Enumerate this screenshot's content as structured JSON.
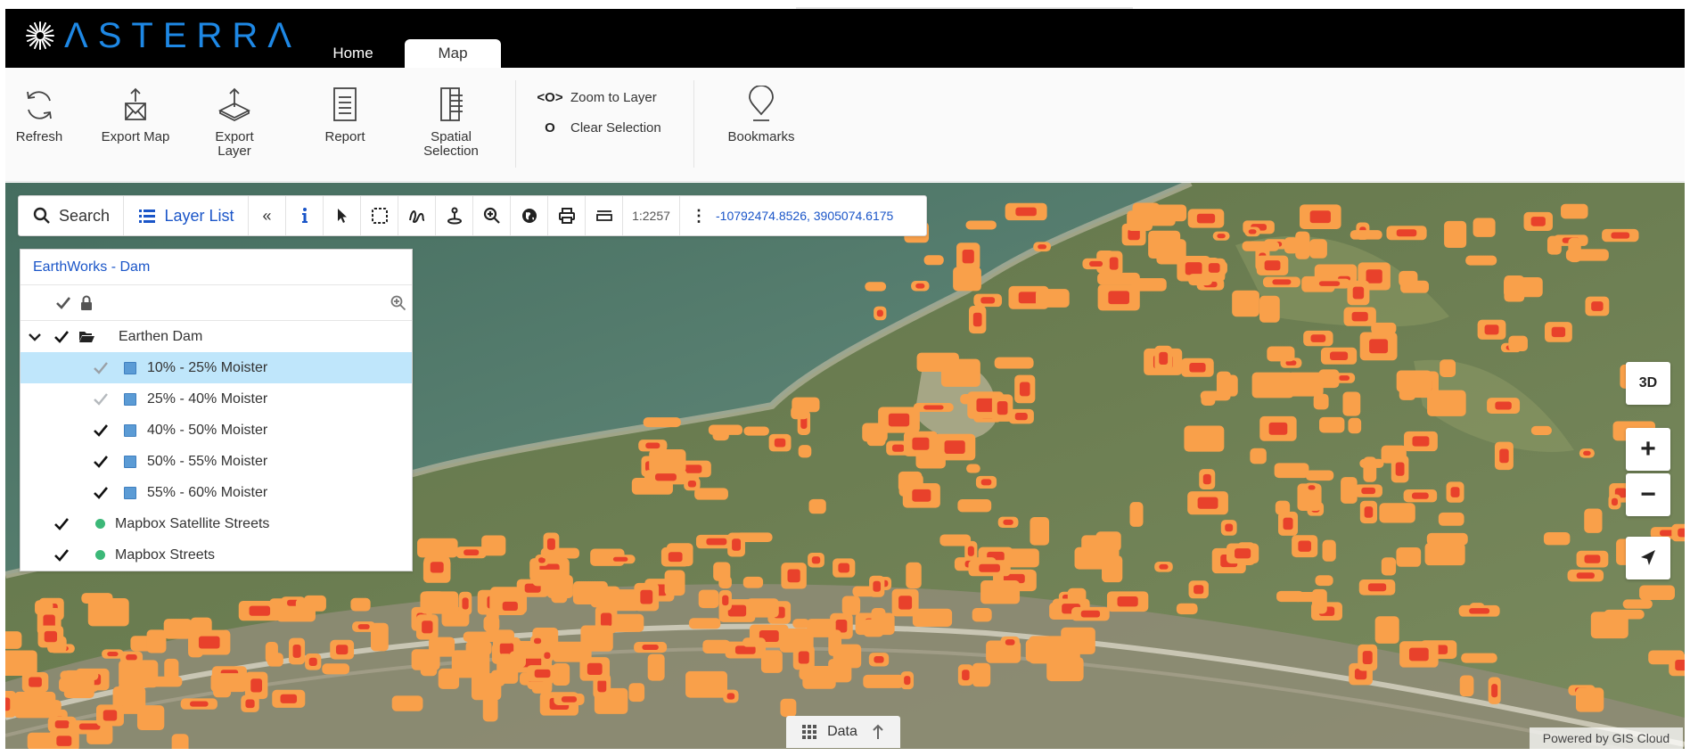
{
  "brand": {
    "logo_text": "ΛSTERRΛ"
  },
  "tabs": [
    {
      "label": "Home"
    },
    {
      "label": "Map"
    }
  ],
  "ribbon": {
    "refresh": "Refresh",
    "export_map": "Export Map",
    "export_layer_1": "Export",
    "export_layer_2": "Layer",
    "report": "Report",
    "spatial_1": "Spatial",
    "spatial_2": "Selection",
    "zoom_glyph": "<O>",
    "zoom_to_layer": "Zoom to Layer",
    "clear_glyph": "O",
    "clear_selection": "Clear Selection",
    "bookmarks": "Bookmarks"
  },
  "toolbar": {
    "search": "Search",
    "layer_list": "Layer List",
    "collapse": "«",
    "scale": "1:2257",
    "coordinates": "-10792474.8526, 3905074.6175"
  },
  "layer_panel": {
    "title_project": "EarthWorks",
    "title_sep": " - ",
    "title_layer": "Dam",
    "group": "Earthen Dam",
    "layers": [
      {
        "label": "10% - 25% Moister"
      },
      {
        "label": "25% - 40% Moister"
      },
      {
        "label": "40% - 50% Moister"
      },
      {
        "label": "50% - 55% Moister"
      },
      {
        "label": "55% - 60% Moister"
      }
    ],
    "basemaps": [
      {
        "label": "Mapbox Satellite Streets"
      },
      {
        "label": "Mapbox Streets"
      }
    ]
  },
  "map_controls": {
    "three_d": "3D",
    "zoom_in": "+",
    "zoom_out": "−"
  },
  "data_bar": {
    "label": "Data"
  },
  "attribution": "Powered by GIS Cloud",
  "colors": {
    "header_bg": "#000000",
    "brand_blue": "#1e88e5",
    "link_blue": "#1a55c8",
    "selected_row": "#bfe6fb",
    "heat_orange": "#f9a04a",
    "heat_red": "#e8412b"
  }
}
